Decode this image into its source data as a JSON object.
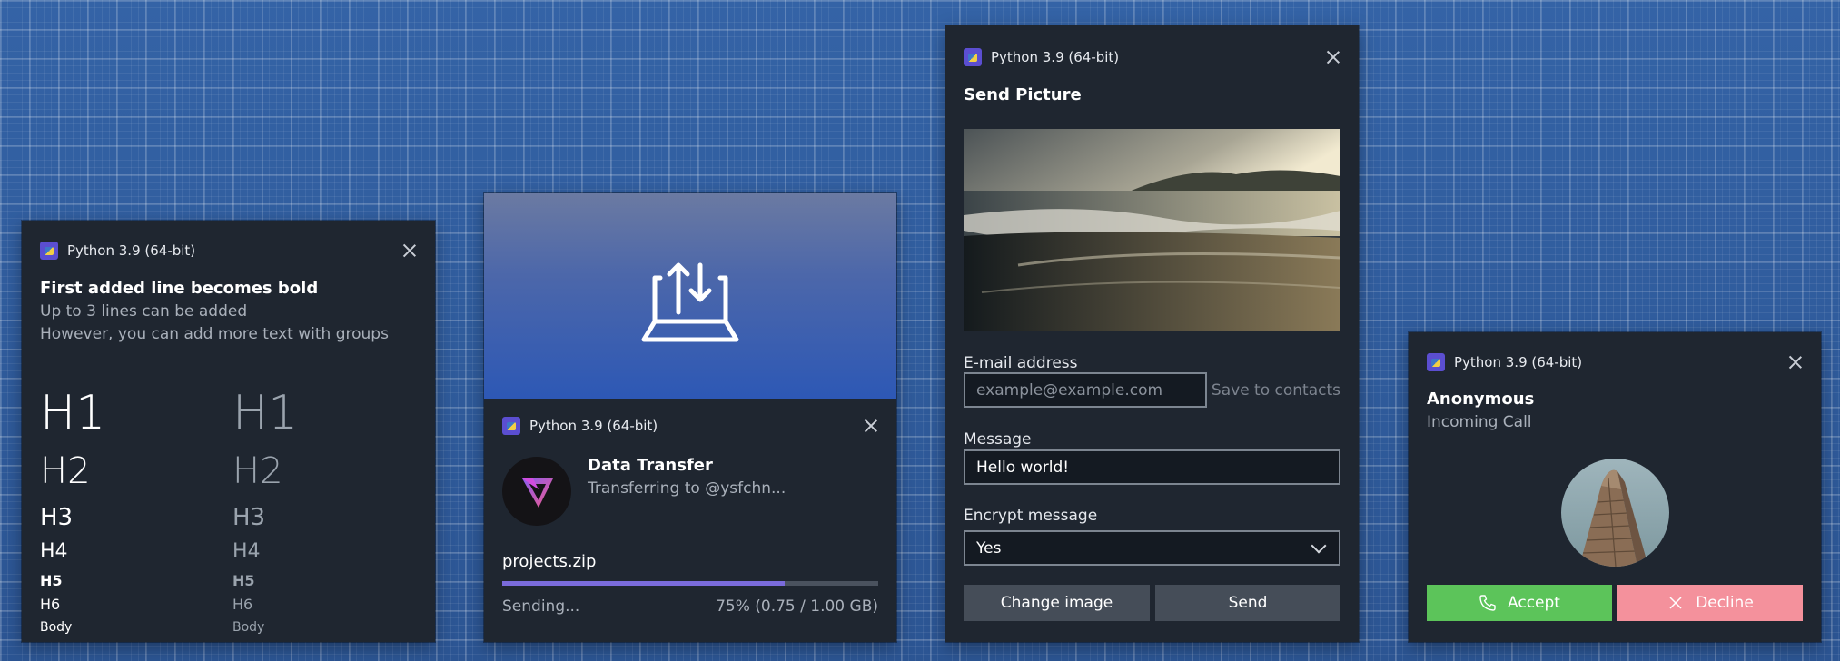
{
  "app_name": "Python 3.9 (64-bit)",
  "toast_basic": {
    "title": "First added line becomes bold",
    "line2": "Up to 3 lines can be added",
    "line3": "However, you can add more text with groups",
    "headings": [
      "H1",
      "H2",
      "H3",
      "H4",
      "H5",
      "H6",
      "Body"
    ]
  },
  "toast_transfer": {
    "title": "Data Transfer",
    "subtitle": "Transferring to @ysfchn...",
    "file_name": "projects.zip",
    "status": "Sending...",
    "progress_text": "75% (0.75 / 1.00 GB)",
    "progress_fraction": 0.75,
    "accent_color": "#7a6bdb"
  },
  "toast_picture": {
    "title": "Send Picture",
    "email_label": "E-mail address",
    "email_placeholder": "example@example.com",
    "save_link": "Save to contacts",
    "message_label": "Message",
    "message_value": "Hello world!",
    "encrypt_label": "Encrypt message",
    "encrypt_value": "Yes",
    "change_image_button": "Change image",
    "send_button": "Send"
  },
  "toast_call": {
    "caller": "Anonymous",
    "subtitle": "Incoming Call",
    "accept_button": "Accept",
    "decline_button": "Decline",
    "accept_color": "#5cc45a",
    "decline_color": "#f4919c"
  }
}
